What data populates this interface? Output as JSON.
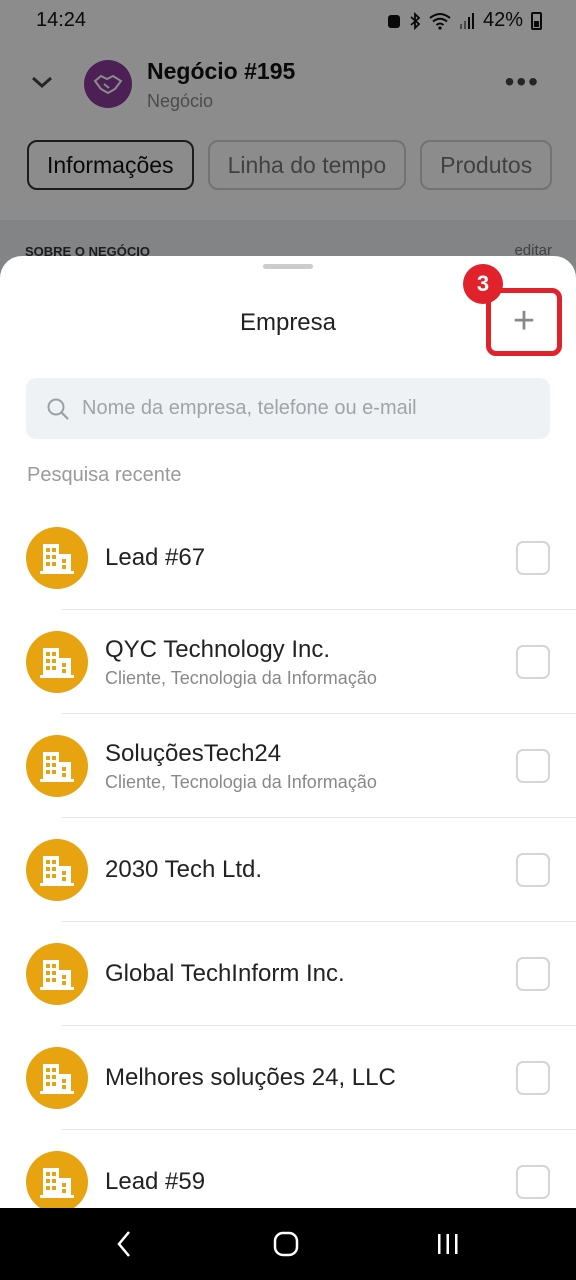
{
  "status_bar": {
    "time": "14:24",
    "battery_text": "42%",
    "icons": [
      "alarm-icon",
      "bluetooth-icon",
      "wifi-icon",
      "signal-icon",
      "battery-icon"
    ]
  },
  "header": {
    "title": "Negócio #195",
    "subtitle": "Negócio",
    "more_label": "•••"
  },
  "tabs": [
    {
      "label": "Informações",
      "active": true
    },
    {
      "label": "Linha do tempo",
      "active": false
    },
    {
      "label": "Produtos",
      "active": false
    }
  ],
  "section": {
    "title": "SOBRE O NEGÓCIO",
    "edit_label": "editar"
  },
  "sheet": {
    "title": "Empresa",
    "add_label": "+",
    "badge": "3",
    "search_placeholder": "Nome da empresa, telefone ou e-mail",
    "search_value": "",
    "recent_label": "Pesquisa recente",
    "items": [
      {
        "name": "Lead #67",
        "sub": ""
      },
      {
        "name": "QYC Technology Inc.",
        "sub": "Cliente, Tecnologia da Informação"
      },
      {
        "name": "SoluçõesTech24",
        "sub": "Cliente, Tecnologia da Informação"
      },
      {
        "name": "2030 Tech Ltd.",
        "sub": ""
      },
      {
        "name": "Global TechInform Inc.",
        "sub": ""
      },
      {
        "name": "Melhores soluções 24, LLC",
        "sub": ""
      },
      {
        "name": "Lead #59",
        "sub": ""
      }
    ]
  },
  "colors": {
    "accent_red": "#e0222b",
    "company_avatar": "#e8a311",
    "deal_avatar": "#8a3a9c"
  }
}
